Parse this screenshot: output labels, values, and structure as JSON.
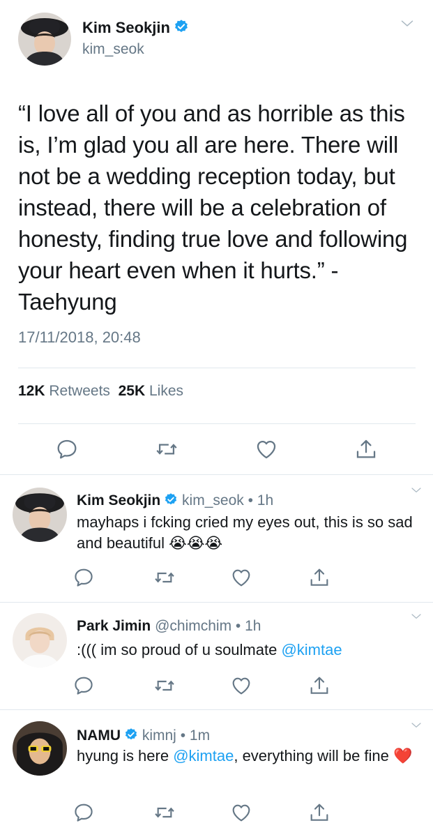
{
  "main_tweet": {
    "author_name": "Kim Seokjin",
    "handle": "kim_seok",
    "text": "“I love all of you and as horrible as this is, I’m glad you all are here. There will not be a wedding reception today, but instead, there will be a celebration of honesty, finding true love and following your heart even when it hurts.” - Taehyung",
    "timestamp": "17/11/2018, 20:48",
    "retweets_count": "12K",
    "retweets_label": "Retweets",
    "likes_count": "25K",
    "likes_label": "Likes"
  },
  "replies": [
    {
      "author_name": "Kim Seokjin",
      "verified": true,
      "handle": "kim_seok",
      "time": "1h",
      "text": "mayhaps i fcking cried my eyes out, this is so sad and beautiful",
      "emoji": "😭😭😭"
    },
    {
      "author_name": "Park Jimin",
      "verified": false,
      "handle": "@chimchim",
      "time": "1h",
      "text_before": ":((( im so proud of u soulmate ",
      "mention": "@kimtae"
    },
    {
      "author_name": "NAMU",
      "verified": true,
      "handle": "kimnj",
      "time": "1m",
      "text_before": "hyung is here ",
      "mention": "@kimtae",
      "text_after": ", everything will be fine",
      "emoji": "❤️"
    }
  ],
  "colors": {
    "accent": "#1da1f2",
    "muted": "#657786",
    "divider": "#e1e8ed",
    "text": "#14171a"
  },
  "icons": [
    "reply-icon",
    "retweet-icon",
    "like-icon",
    "share-icon",
    "verified-badge-icon",
    "chevron-down-icon"
  ]
}
